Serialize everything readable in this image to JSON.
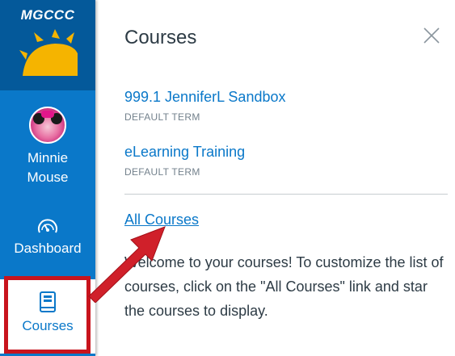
{
  "nav": {
    "logo_text": "MGCCC",
    "account_first": "Minnie",
    "account_last": "Mouse",
    "dashboard_label": "Dashboard",
    "courses_label": "Courses"
  },
  "tray": {
    "title": "Courses",
    "courses": [
      {
        "name": "999.1 JenniferL Sandbox",
        "term": "DEFAULT TERM"
      },
      {
        "name": "eLearning Training",
        "term": "DEFAULT TERM"
      }
    ],
    "all_courses_label": "All Courses",
    "welcome_text": "Welcome to your courses! To customize the list of courses, click on the \"All Courses\" link and star the courses to display."
  },
  "colors": {
    "nav_blue": "#0a78c9",
    "logo_blue": "#04599a",
    "link_blue": "#0a78c9",
    "highlight_red": "#c8141d",
    "text_dark": "#2d3b45",
    "term_gray": "#73818c"
  },
  "icons": {
    "close": "close-icon",
    "dashboard": "speedometer-icon",
    "courses": "book-icon",
    "logo": "sun-icon"
  }
}
